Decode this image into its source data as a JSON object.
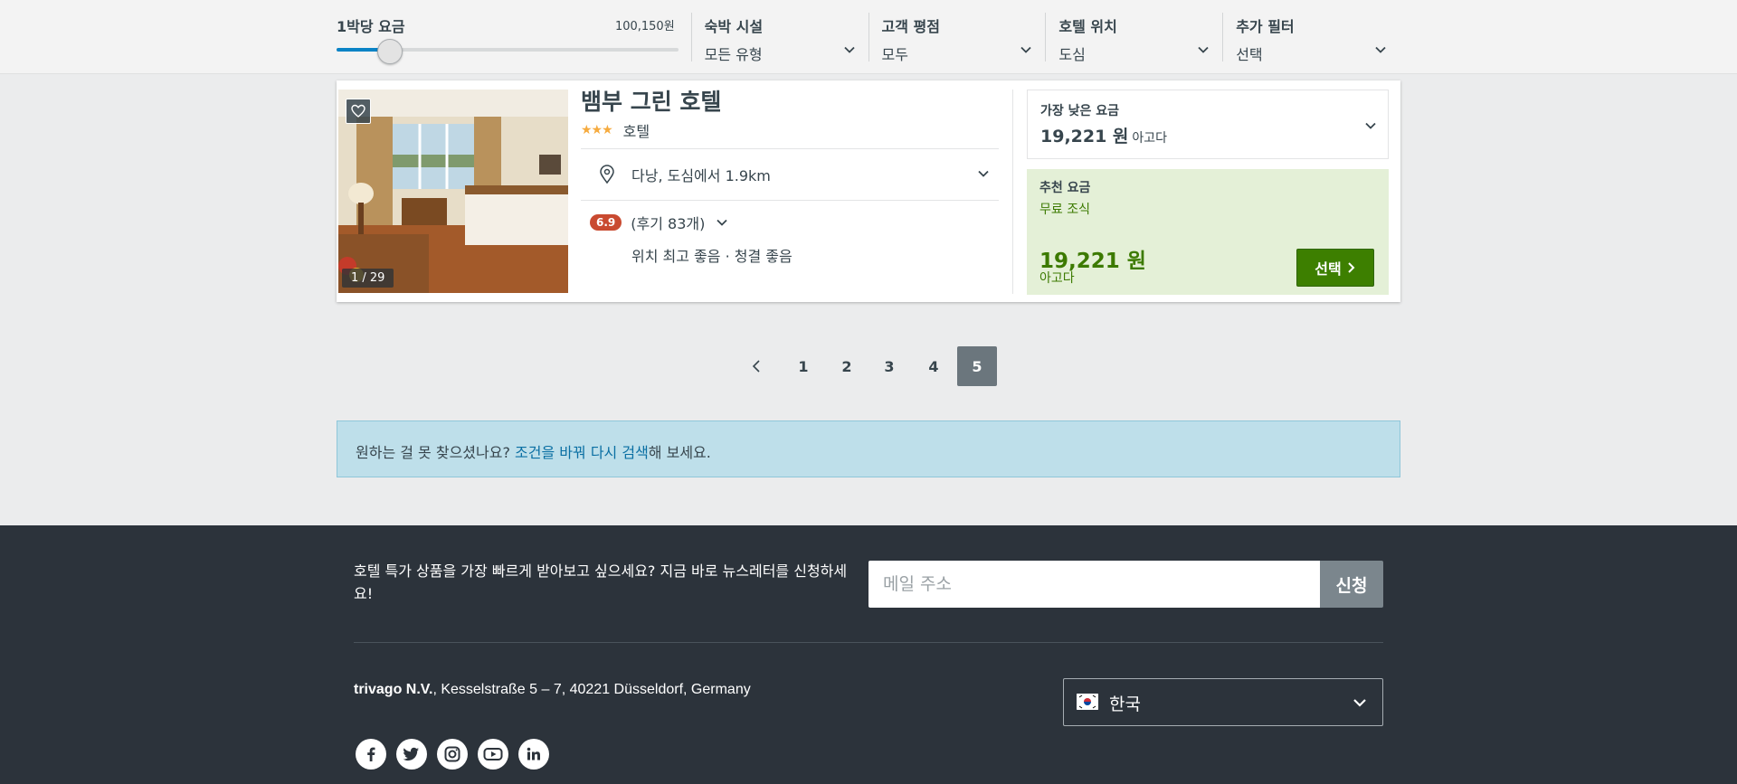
{
  "filters": {
    "price": {
      "label": "1박당 요금",
      "value": "100,150원",
      "fraction": 0.13
    },
    "property_type": {
      "label": "숙박 시설",
      "value": "모든 유형"
    },
    "guest_rating": {
      "label": "고객 평점",
      "value": "모두"
    },
    "location": {
      "label": "호텔 위치",
      "value": "도심"
    },
    "more": {
      "label": "추가 필터",
      "value": "선택"
    }
  },
  "hotel": {
    "photo_counter": "1 / 29",
    "name": "뱀부 그린 호텔",
    "stars": "★★★",
    "star_count": 3,
    "type": "호텔",
    "location": "다낭, 도심에서 1.9km",
    "rating": "6.9",
    "reviews": "(후기 83개)",
    "review_summary": "위치 최고 좋음 · 청결 좋음",
    "lowest": {
      "label": "가장 낮은 요금",
      "price": "19,221 원",
      "site": "아고다"
    },
    "recommended": {
      "label": "추천 요금",
      "breakfast": "무료 조식",
      "price": "19,221 원",
      "site": "아고다",
      "button": "선택"
    }
  },
  "pagination": {
    "pages": [
      "1",
      "2",
      "3",
      "4",
      "5"
    ],
    "active": "5"
  },
  "notice": {
    "before": "원하는 걸 못 찾으셨나요? ",
    "link": "조건을 바꿔 다시 검색",
    "after": "해 보세요."
  },
  "footer": {
    "newsletter_text": "호텔 특가 상품을 가장 빠르게 받아보고 싶으세요? 지금 바로 뉴스레터를 신청하세요!",
    "email_placeholder": "메일 주소",
    "subscribe": "신청",
    "company": "trivago N.V.",
    "address": ", Kesselstraße 5 – 7, 40221 Düsseldorf, Germany",
    "country": "한국",
    "socials": [
      "facebook-icon",
      "twitter-icon",
      "instagram-icon",
      "youtube-icon",
      "linkedin-icon"
    ]
  },
  "colors": {
    "accent_blue": "#0a83c6",
    "cta_green": "#3d7f00",
    "rating_red": "#c94a30",
    "footer_bg": "#2c333b",
    "active_page": "#6b767d"
  }
}
